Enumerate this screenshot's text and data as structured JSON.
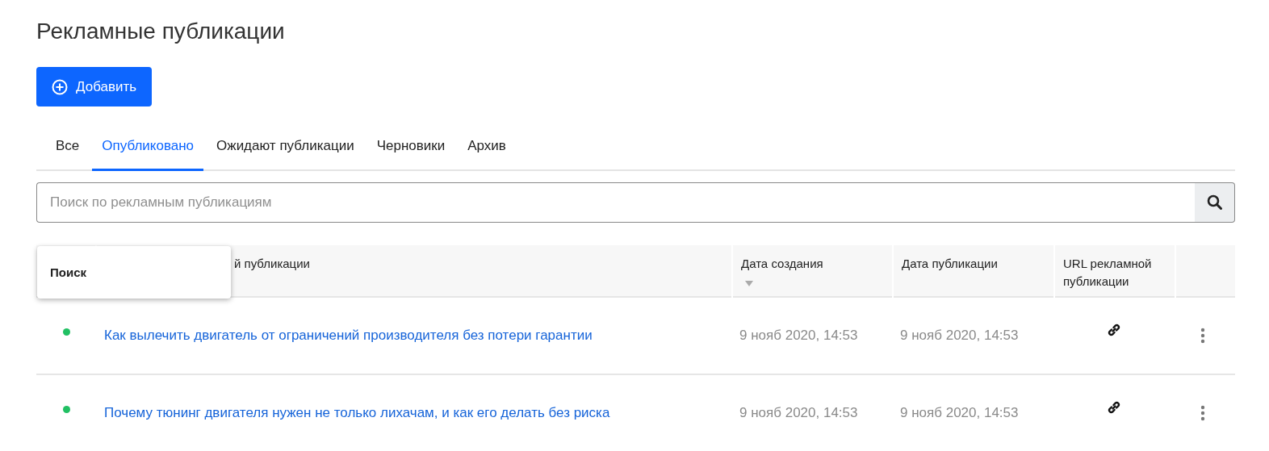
{
  "page_title": "Рекламные публикации",
  "add_button": {
    "label": "Добавить"
  },
  "tabs": [
    {
      "label": "Все",
      "selected": false
    },
    {
      "label": "Опубликовано",
      "selected": true
    },
    {
      "label": "Ожидают публикации",
      "selected": false
    },
    {
      "label": "Черновики",
      "selected": false
    },
    {
      "label": "Архив",
      "selected": false
    }
  ],
  "search": {
    "placeholder": "Поиск по рекламным публикациям",
    "suggestion": "Поиск"
  },
  "table": {
    "columns": [
      {
        "label": "й публикации",
        "sorted": false
      },
      {
        "label": "Дата создания",
        "sorted": true
      },
      {
        "label": "Дата публикации",
        "sorted": false
      },
      {
        "label": "URL рекламной публикации",
        "sorted": false
      }
    ],
    "rows": [
      {
        "color": "#21c063",
        "title": "Как вылечить двигатель от ограничений производителя без потери гарантии",
        "created": "9 нояб 2020, 14:53",
        "published": "9 нояб 2020, 14:53"
      },
      {
        "color": "#21c063",
        "title": "Почему тюнинг двигателя нужен не только лихачам, и как его делать без риска",
        "created": "9 нояб 2020, 14:53",
        "published": "9 нояб 2020, 14:53"
      }
    ]
  }
}
